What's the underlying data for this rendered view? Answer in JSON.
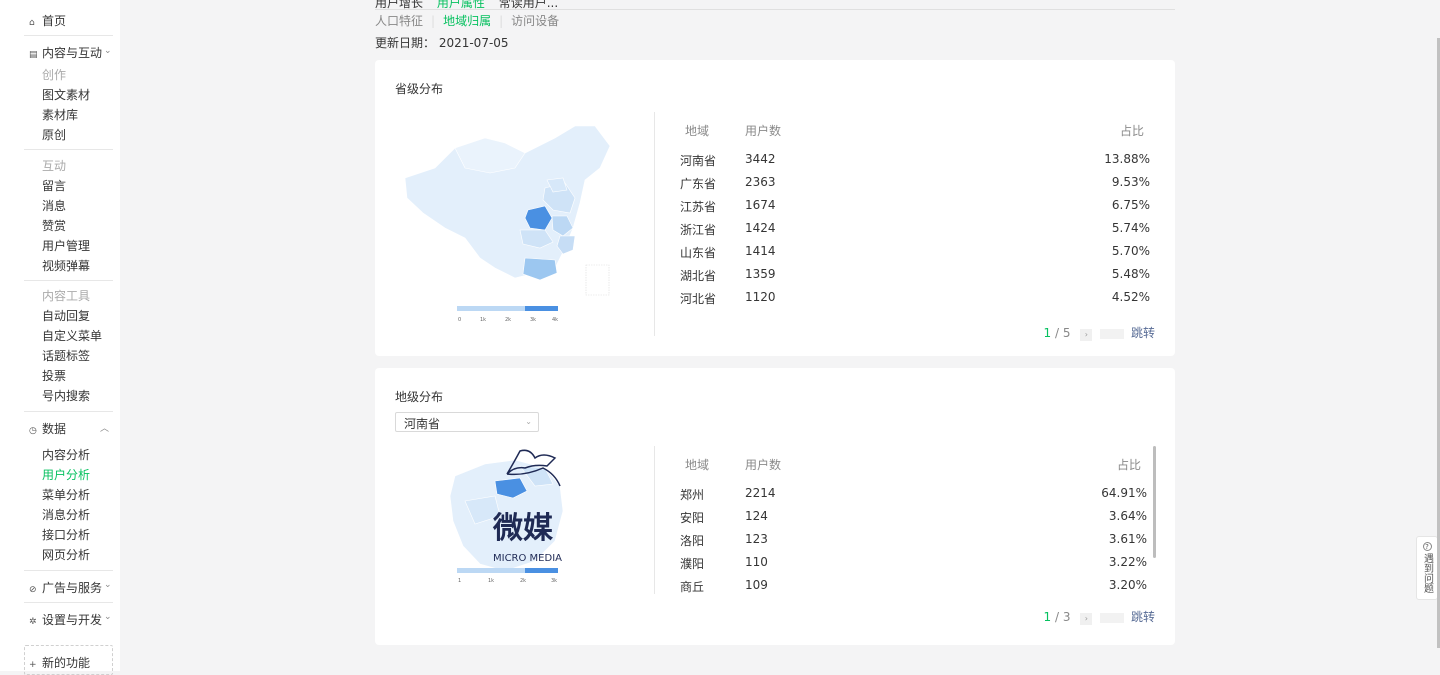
{
  "sidebar": {
    "home": "首页",
    "content_interact": "内容与互动",
    "sec_create": "创作",
    "create_items": [
      "图文素材",
      "素材库",
      "原创"
    ],
    "sec_interact": "互动",
    "interact_items": [
      "留言",
      "消息",
      "赞赏",
      "用户管理",
      "视频弹幕"
    ],
    "sec_tools": "内容工具",
    "tools_items": [
      "自动回复",
      "自定义菜单",
      "话题标签",
      "投票",
      "号内搜索"
    ],
    "data": "数据",
    "data_items": [
      "内容分析",
      "用户分析",
      "菜单分析",
      "消息分析",
      "接口分析",
      "网页分析"
    ],
    "ads": "广告与服务",
    "settings": "设置与开发",
    "new_features": "新的功能"
  },
  "tabs": [
    "用户增长",
    "用户属性",
    "常读用户..."
  ],
  "subtabs": [
    "人口特征",
    "地域归属",
    "访问设备"
  ],
  "update_date": "更新日期： 2021-07-05",
  "province_card": {
    "title": "省级分布",
    "headers": [
      "地域",
      "用户数",
      "占比"
    ],
    "rows": [
      [
        "河南省",
        "3442",
        "13.88%"
      ],
      [
        "广东省",
        "2363",
        "9.53%"
      ],
      [
        "江苏省",
        "1674",
        "6.75%"
      ],
      [
        "浙江省",
        "1424",
        "5.74%"
      ],
      [
        "山东省",
        "1414",
        "5.70%"
      ],
      [
        "湖北省",
        "1359",
        "5.48%"
      ],
      [
        "河北省",
        "1120",
        "4.52%"
      ]
    ],
    "legend": [
      "0",
      "1k",
      "2k",
      "3k",
      "4k"
    ],
    "page_current": "1",
    "page_total": "/ 5",
    "jump": "跳转"
  },
  "city_card": {
    "title": "地级分布",
    "select_value": "河南省",
    "headers": [
      "地域",
      "用户数",
      "占比"
    ],
    "rows": [
      [
        "郑州",
        "2214",
        "64.91%"
      ],
      [
        "安阳",
        "124",
        "3.64%"
      ],
      [
        "洛阳",
        "123",
        "3.61%"
      ],
      [
        "濮阳",
        "110",
        "3.22%"
      ],
      [
        "商丘",
        "109",
        "3.20%"
      ]
    ],
    "legend": [
      "1",
      "1k",
      "2k",
      "3k"
    ],
    "page_current": "1",
    "page_total": "/ 3",
    "jump": "跳转"
  },
  "watermark": {
    "cn": "微媒",
    "en": "MICRO MEDIA"
  },
  "help": "遇到问题",
  "colors": {
    "accent": "#07c160",
    "link": "#576b95",
    "map_high": "#4a90e2",
    "map_low": "#e3effb"
  }
}
